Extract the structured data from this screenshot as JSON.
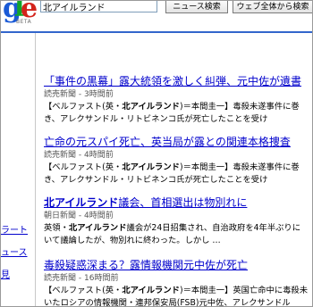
{
  "header": {
    "logo_letters": [
      "g",
      "l",
      "e"
    ],
    "logo_colors": [
      "#1a5ad6",
      "#12a42a",
      "#d3231b"
    ],
    "beta": "BETA",
    "search_value": "北アイルランド",
    "news_search_button": "ニュース検索",
    "web_search_button": "ウェブ全体から検索",
    "accent_color": "#3366cc"
  },
  "sidebar": {
    "items": [
      {
        "label": "ラート"
      },
      {
        "label": "ュース"
      },
      {
        "label": "見"
      }
    ]
  },
  "results": [
    {
      "title": "「事件の黒幕」露大統領を激しく糾弾、元中佐が遺書",
      "source": "読売新聞",
      "sep": " - ",
      "time": "3時間前",
      "snippet1_pre": "【ベルファスト(英・",
      "snippet1_bold": "北アイルランド",
      "snippet1_post": ")＝本間圭一】毒殺未遂事件に巻",
      "snippet2": "き、アレクサンドル・リトビネンコ氏が死亡したことを受け"
    },
    {
      "title": "亡命の元スパイ死亡、英当局が露との関連本格捜査",
      "source": "読売新聞",
      "sep": " - ",
      "time": "4時間前",
      "snippet1_pre": "【ベルファスト(英・",
      "snippet1_bold": "北アイルランド",
      "snippet1_post": ")＝本間圭一】毒殺未遂事件に巻",
      "snippet2": "き、アレクサンドル・リトビネンコ氏が死亡したことを受け"
    },
    {
      "title": "北アイルランド議会、首相選出は物別れに",
      "title_bold": "北アイルランド",
      "title_rest": "議会、首相選出は物別れに",
      "source": "朝日新聞",
      "sep": " - ",
      "time": "4時間前",
      "snippet1_pre": "英領・",
      "snippet1_bold": "北アイルランド",
      "snippet1_post": "議会が24日招集され、自治政府を4年半ぶりに",
      "snippet2": "いて議論したが、物別れに終わった。しかし …"
    },
    {
      "title": "毒殺疑惑深まる？露情報機関元中佐が死亡",
      "source": "読売新聞",
      "sep": " - ",
      "time": "16時間前",
      "snippet1_pre": "【ベルファスト(英・",
      "snippet1_bold": "北アイルランド",
      "snippet1_post": ")＝本間圭一】英国亡命中に毒殺未",
      "snippet2": "いたロシアの情報機関・連邦保安局(FSB)元中佐、アレクサンドル"
    }
  ]
}
